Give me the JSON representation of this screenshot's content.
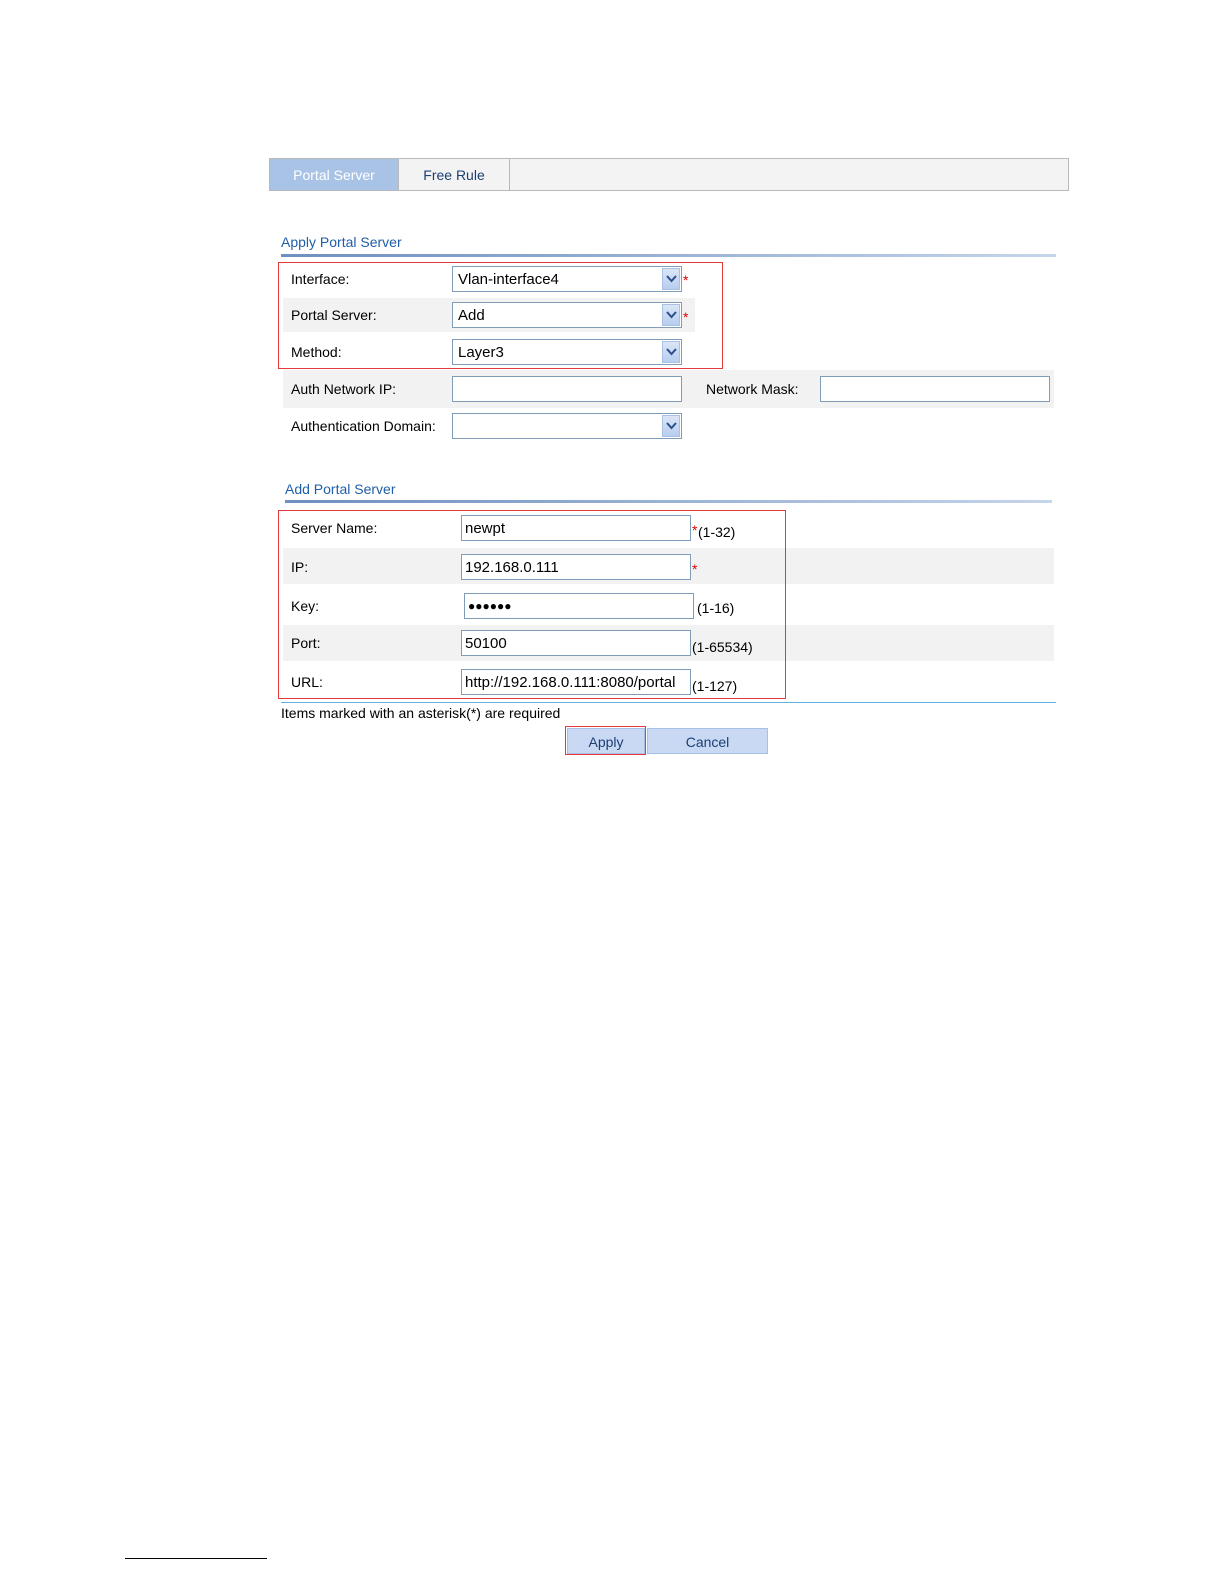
{
  "tabs": [
    {
      "label": "Portal Server"
    },
    {
      "label": "Free Rule"
    }
  ],
  "apply_section": {
    "title": "Apply Portal Server",
    "interface": {
      "label": "Interface:",
      "value": "Vlan-interface4",
      "required": "*"
    },
    "portal_server": {
      "label": "Portal Server:",
      "value": "Add",
      "required": "*"
    },
    "method": {
      "label": "Method:",
      "value": "Layer3"
    },
    "auth_network_ip": {
      "label": "Auth Network IP:",
      "value": ""
    },
    "network_mask": {
      "label": "Network Mask:",
      "value": ""
    },
    "auth_domain": {
      "label": "Authentication Domain:",
      "value": ""
    }
  },
  "add_section": {
    "title": "Add Portal Server",
    "server_name": {
      "label": "Server Name:",
      "value": "newpt",
      "required": "*",
      "hint": "(1-32)"
    },
    "ip": {
      "label": "IP:",
      "value": "192.168.0.111",
      "required": "*"
    },
    "key": {
      "label": "Key:",
      "value": "●●●●●●",
      "hint": "(1-16)"
    },
    "port": {
      "label": "Port:",
      "value": "50100",
      "hint": "(1-65534)"
    },
    "url": {
      "label": "URL:",
      "value": "http://192.168.0.111:8080/portal",
      "hint": "(1-127)"
    }
  },
  "footer_note": "Items marked with an asterisk(*) are required",
  "buttons": {
    "apply": "Apply",
    "cancel": "Cancel"
  },
  "colors": {
    "highlight": "#e53838",
    "required": "#e00000",
    "title": "#1f5ea8",
    "tab_active": "#a9c3e6"
  }
}
